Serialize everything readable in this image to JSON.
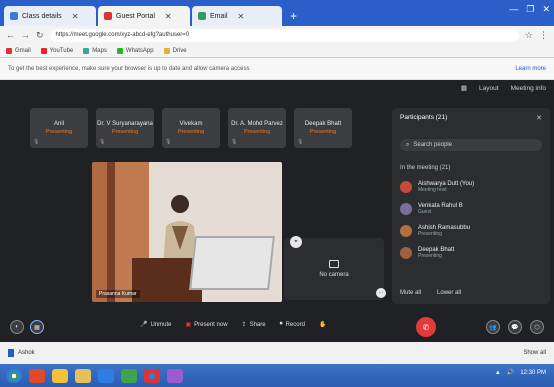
{
  "browser": {
    "tabs": [
      {
        "label": "Class details",
        "active": false
      },
      {
        "label": "Guest Portal",
        "active": true
      },
      {
        "label": "Email",
        "active": false
      }
    ],
    "new_tab_symbol": "+",
    "window_controls": [
      "—",
      "❐",
      "✕"
    ],
    "url": "https://meet.google.com/xyz-abcd-efg?authuser=0",
    "bookmarks": [
      "Gmail",
      "YouTube",
      "Maps",
      "WhatsApp",
      "Drive"
    ],
    "infobar_text": "To get the best experience, make sure your browser is up to date and allow camera access",
    "infobar_action": "Learn more"
  },
  "meet": {
    "topbar": {
      "layout_label": "Layout",
      "meeting_label": "Meeting info"
    },
    "tiles": [
      {
        "name": "Anil",
        "sub": "Presenting"
      },
      {
        "name": "Dr. V Suryanarayana",
        "sub": "Presenting"
      },
      {
        "name": "Vivekam",
        "sub": "Presenting"
      },
      {
        "name": "Dr. A. Mohd Parvez",
        "sub": "Presenting"
      },
      {
        "name": "Deepak Bhatt",
        "sub": "Presenting"
      }
    ],
    "video_caption": "Prasanna Kumar",
    "self_view_label": "No camera",
    "participants": {
      "title": "Participants (21)",
      "search_placeholder": "Search people",
      "section": "In the meeting (21)",
      "people": [
        {
          "name": "Aishwarya Dutt (You)",
          "sub": "Meeting host"
        },
        {
          "name": "Venkata Rahul B",
          "sub": "Guest"
        },
        {
          "name": "Ashish Ramasubbu",
          "sub": "Presenting"
        },
        {
          "name": "Deepak Bhatt",
          "sub": "Presenting"
        }
      ],
      "mute_all": "Mute all",
      "lower_all": "Lower all"
    },
    "controls": {
      "mic_label": "Unmute",
      "present_label": "Present now",
      "share_label": "Share",
      "record_label": "Record",
      "end_symbol": "✆"
    }
  },
  "download_bar": {
    "file": "Ashok",
    "show_all": "Show all"
  },
  "taskbar": {
    "clock": "12:30 PM",
    "icon_colors": [
      "#e04a2a",
      "#3fa34d",
      "#f3c13a",
      "#2d7de2",
      "#9c59d1",
      "#e67e22",
      "#d33",
      "#ffffff"
    ]
  }
}
